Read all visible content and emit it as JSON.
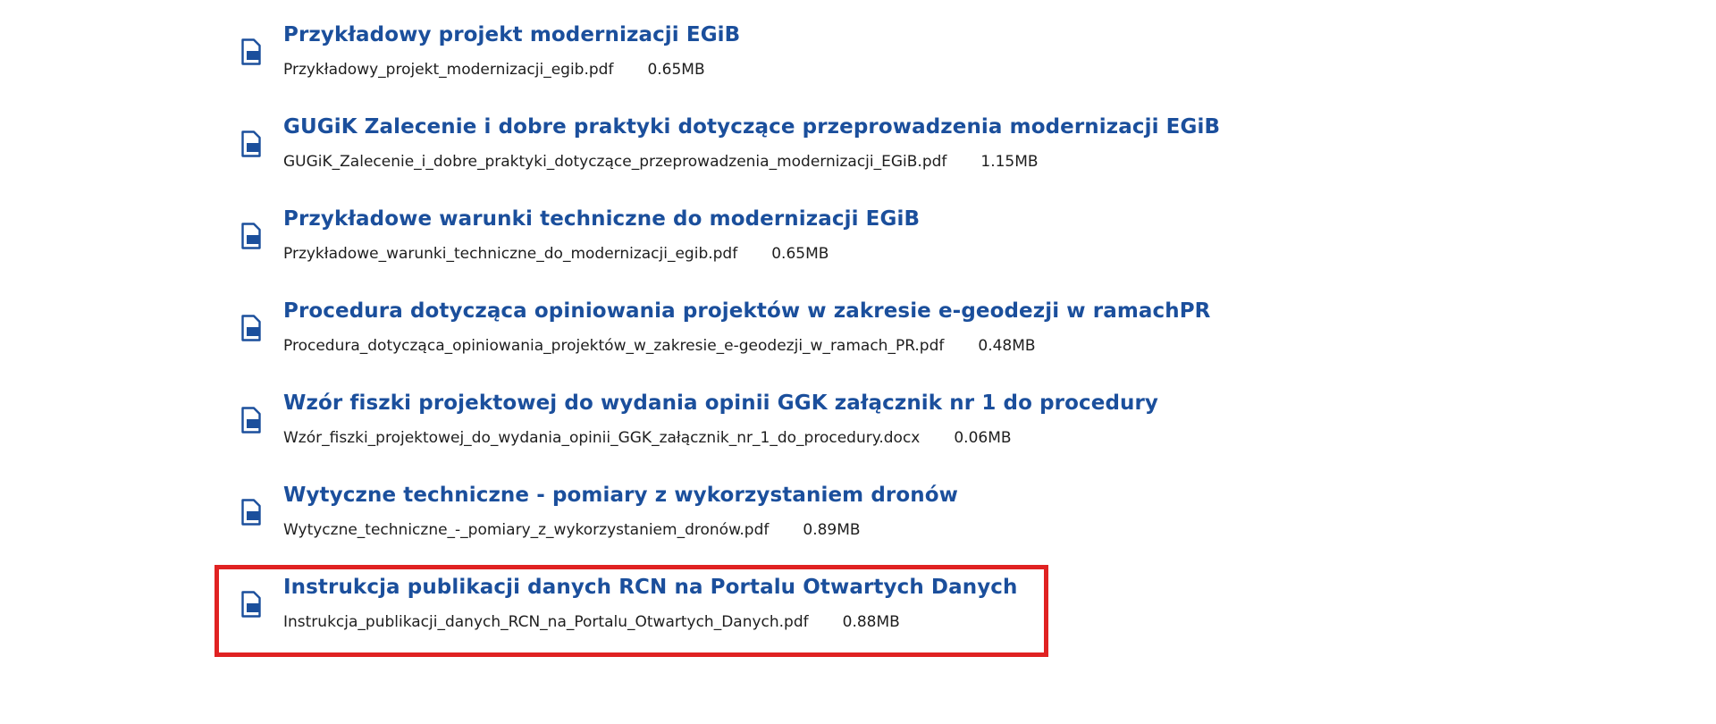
{
  "attachments": [
    {
      "title": "Przykładowy projekt modernizacji EGiB",
      "filename": "Przykładowy_projekt_modernizacji_egib.pdf",
      "size": "0.65MB",
      "icon": "file-icon"
    },
    {
      "title": "GUGiK Zalecenie i dobre praktyki dotyczące przeprowadzenia modernizacji EGiB",
      "filename": "GUGiK_Zalecenie_i_dobre_praktyki_dotyczące_przeprowadzenia_modernizacji_EGiB.pdf",
      "size": "1.15MB",
      "icon": "file-icon"
    },
    {
      "title": "Przykładowe warunki techniczne do modernizacji EGiB",
      "filename": "Przykładowe_warunki_techniczne_do_modernizacji_egib.pdf",
      "size": "0.65MB",
      "icon": "file-icon"
    },
    {
      "title": "Procedura dotycząca opiniowania projektów w zakresie e-geodezji w ramachPR",
      "filename": "Procedura_dotycząca_opiniowania_projektów_w_zakresie_e-geodezji_w_ramach_PR.pdf",
      "size": "0.48MB",
      "icon": "file-icon"
    },
    {
      "title": "Wzór fiszki projektowej do wydania opinii GGK załącznik nr 1 do procedury",
      "filename": "Wzór_fiszki_projektowej_do_wydania_opinii_GGK_załącznik_nr_1_do_procedury.docx",
      "size": "0.06MB",
      "icon": "file-icon"
    },
    {
      "title": "Wytyczne techniczne - pomiary z wykorzystaniem dronów",
      "filename": "Wytyczne_techniczne_-_pomiary_z_wykorzystaniem_dronów.pdf",
      "size": "0.89MB",
      "icon": "file-icon"
    },
    {
      "title": "Instrukcja publikacji danych RCN na Portalu Otwartych Danych",
      "filename": "Instrukcja_publikacji_danych_RCN_na_Portalu_Otwartych_Danych.pdf",
      "size": "0.88MB",
      "icon": "file-icon",
      "highlighted": true
    }
  ],
  "colors": {
    "link": "#1b4f9c",
    "text": "#1e1e1e",
    "highlight": "#e02222"
  }
}
